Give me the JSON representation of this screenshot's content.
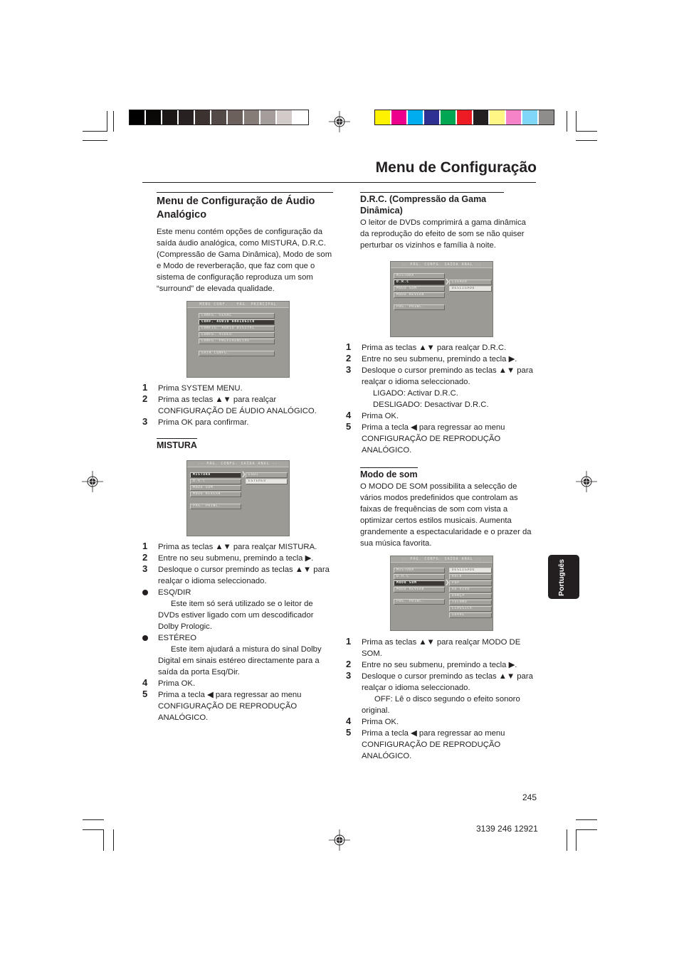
{
  "print_marks": {
    "grayscale_swatches": [
      "#000000",
      "#0b0908",
      "#1b1716",
      "#272221",
      "#3c3331",
      "#534a47",
      "#6b605c",
      "#857b77",
      "#a49d9b",
      "#d2cbca",
      "#ffffff"
    ],
    "color_swatches": [
      "#fff200",
      "#ec008c",
      "#00aeef",
      "#2e3192",
      "#00a651",
      "#ed1c24",
      "#231f20",
      "#fff685",
      "#f583c7",
      "#7fd6f7",
      "#8f8c8c"
    ]
  },
  "header": {
    "page_title": "Menu de Configuração"
  },
  "left_column": {
    "section_title": "Menu de Configuração de Áudio Analógico",
    "intro": "Este menu contém opções de configuração da saída áudio analógica, como MISTURA, D.R.C. (Compressão de Gama Dinâmica), Modo de som e Modo de reverberação, que faz com que o sistema de configuração reproduza um som “surround” de elevada qualidade.",
    "screen_main": {
      "header": "MENU CONF. - PÁG. PRINCIPAL",
      "items": [
        "CONFG. GERAL",
        "CONF. ÁUDIO ANALÓGICO",
        "CONFIG. ÁUDIO DIGITAL",
        "CONFG. VÍDEO",
        "CONFG. PREFERÊNCIAS"
      ],
      "selected": "CONF. ÁUDIO ANALÓGICO",
      "exit": "SAIR CONFG."
    },
    "steps_intro": [
      {
        "num": "1",
        "text": "Prima SYSTEM MENU."
      },
      {
        "num": "2",
        "text": "Prima as teclas ▲▼ para realçar CONFIGURAÇÃO DE ÁUDIO ANALÓGICO."
      },
      {
        "num": "3",
        "text": "Prima OK para confirmar."
      }
    ],
    "mistura": {
      "title": "MISTURA",
      "screen": {
        "header": "-- PÁG. CONFG. SAÍDA ANAL --",
        "menu": [
          "MISTURA",
          "D.R.C",
          "MODO SOM",
          "MODO REVERB"
        ],
        "back": "PÁG. PRINC.",
        "submenu": [
          "ESDI",
          "ESTÉREO"
        ]
      },
      "steps": [
        {
          "num": "1",
          "text": "Prima as teclas ▲▼ para realçar MISTURA."
        },
        {
          "num": "2",
          "text": "Entre no seu submenu, premindo a tecla ▶."
        },
        {
          "num": "3",
          "text": "Desloque o cursor premindo as teclas ▲▼ para realçar o idioma seleccionado."
        }
      ],
      "bullets": [
        {
          "label": "ESQ/DIR",
          "desc": "Este item só será utilizado se o leitor de DVDs estiver ligado com um descodificador Dolby Prologic."
        },
        {
          "label": "ESTÉREO",
          "desc": "Este item ajudará a mistura do sinal Dolby Digital em sinais estéreo directamente para a saída da porta Esq/Dir."
        }
      ],
      "steps_end": [
        {
          "num": "4",
          "text": "Prima OK."
        },
        {
          "num": "5",
          "text": "Prima a tecla ◀ para regressar ao menu CONFIGURAÇÃO DE REPRODUÇÃO ANALÓGICO."
        }
      ]
    }
  },
  "right_column": {
    "drc": {
      "title": "D.R.C. (Compressão da Gama Dinâmica)",
      "intro": "O leitor de DVDs comprimirá a gama dinâmica da reprodução do efeito de som se não quiser perturbar os vizinhos e família à noite.",
      "screen": {
        "header": "-- PÁG. CONFG. SAÍDA ANAL --",
        "menu": [
          "MISTURA",
          "D.R.C",
          "MODO SOM",
          "MODO REVERB"
        ],
        "back": "PÁG. PRINC.",
        "submenu": [
          "LIGADO",
          "DESLIGADO"
        ]
      },
      "steps": [
        {
          "num": "1",
          "text": "Prima as teclas ▲▼ para realçar D.R.C."
        },
        {
          "num": "2",
          "text": "Entre no seu submenu, premindo a tecla ▶."
        },
        {
          "num": "3",
          "text": "Desloque o cursor premindo as teclas ▲▼ para realçar o idioma seleccionado."
        }
      ],
      "options": [
        "LIGADO: Activar D.R.C.",
        "DESLIGADO: Desactivar D.R.C."
      ],
      "steps_end": [
        {
          "num": "4",
          "text": "Prima OK."
        },
        {
          "num": "5",
          "text": "Prima a tecla ◀ para regressar ao menu CONFIGURAÇÃO DE REPRODUÇÃO ANALÓGICO."
        }
      ]
    },
    "modo_som": {
      "title": "Modo de som",
      "intro": "O MODO DE SOM possibilita a selecção de vários modos predefinidos que controlam as faixas de frequências de som com vista a optimizar certos estilos musicais. Aumenta grandemente a espectacularidade e o prazer da sua música favorita.",
      "screen": {
        "header": "-- PÁG. CONFG. SAÍDA ANAL --",
        "menu": [
          "MISTURA",
          "D.R.C",
          "MODO SOM",
          "MODO REVERB"
        ],
        "back": "PÁG. PRINC.",
        "submenu": [
          "DESLIGADO",
          "ROCK",
          "POP",
          "AO VIVO",
          "DANÇA",
          "TECHNO",
          "CLÁSSICA",
          "SUAVE"
        ]
      },
      "steps": [
        {
          "num": "1",
          "text": "Prima as teclas ▲▼ para realçar MODO DE SOM."
        },
        {
          "num": "2",
          "text": "Entre no seu submenu, premindo a tecla ▶."
        },
        {
          "num": "3",
          "text": "Desloque o cursor premindo as teclas ▲▼ para realçar o idioma seleccionado."
        }
      ],
      "note": "OFF: Lê o disco segundo o efeito sonoro original.",
      "steps_end": [
        {
          "num": "4",
          "text": "Prima OK."
        },
        {
          "num": "5",
          "text": "Prima a tecla ◀ para regressar ao menu CONFIGURAÇÃO DE REPRODUÇÃO ANALÓGICO."
        }
      ]
    }
  },
  "language_tab": "Português",
  "footer": {
    "page_number": "245",
    "document_number": "3139 246 12921"
  }
}
